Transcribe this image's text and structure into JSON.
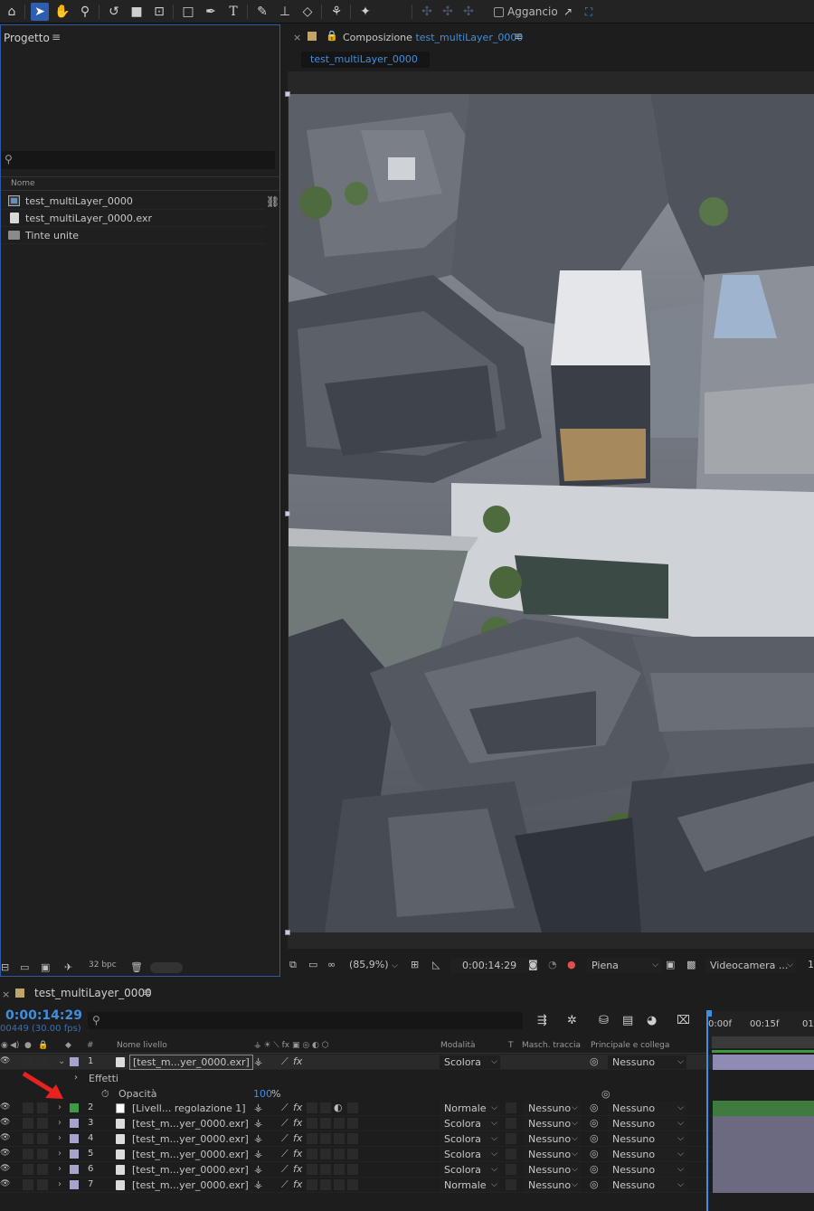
{
  "toolbar": {
    "snap_label": "Aggancio",
    "icons": [
      "home-icon",
      "selection-tool-icon",
      "hand-tool-icon",
      "zoom-tool-icon",
      "rotate-tool-icon",
      "camera-tool-icon",
      "pan-behind-tool-icon",
      "rectangle-tool-icon",
      "pen-tool-icon",
      "type-tool-icon",
      "brush-tool-icon",
      "clone-stamp-tool-icon",
      "eraser-tool-icon",
      "roto-brush-tool-icon",
      "puppet-pin-tool-icon"
    ]
  },
  "project": {
    "title": "Progetto",
    "column_name": "Nome",
    "items": [
      {
        "name": "test_multiLayer_0000",
        "type": "composition"
      },
      {
        "name": "test_multiLayer_0000.exr",
        "type": "footage"
      },
      {
        "name": "Tinte unite",
        "type": "folder"
      }
    ],
    "bit_depth": "32 bpc"
  },
  "composition": {
    "panel_prefix": "Composizione",
    "name": "test_multiLayer_0000",
    "tab": "test_multiLayer_0000",
    "zoom": "(85,9%)",
    "current_time": "0:00:14:29",
    "resolution": "Piena",
    "camera": "Videocamera ...",
    "views": "1"
  },
  "timeline": {
    "title": "test_multiLayer_0000",
    "timecode": "0:00:14:29",
    "frames_info": "00449 (30.00 fps)",
    "ruler_ticks": [
      "0:00f",
      "00:15f",
      "01"
    ],
    "columns": {
      "hash": "#",
      "layer_name": "Nome livello",
      "mode": "Modalità",
      "t": "T",
      "track_matte": "Masch. traccia",
      "parent": "Principale e collega"
    },
    "effects_label": "Effetti",
    "opacity_label": "Opacità",
    "opacity_value": "100",
    "opacity_unit": "%",
    "layers": [
      {
        "num": "1",
        "name": "[test_m...yer_0000.exr]",
        "mode": "Scolora",
        "matte": "",
        "parent": "Nessuno",
        "color": "#a7a3cf",
        "selected": true
      },
      {
        "num": "2",
        "name": "[Livell... regolazione 1]",
        "mode": "Normale",
        "matte": "Nessuno",
        "parent": "Nessuno",
        "color": "#3f9a44",
        "selected": false
      },
      {
        "num": "3",
        "name": "[test_m...yer_0000.exr]",
        "mode": "Scolora",
        "matte": "Nessuno",
        "parent": "Nessuno",
        "color": "#a7a3cf",
        "selected": false
      },
      {
        "num": "4",
        "name": "[test_m...yer_0000.exr]",
        "mode": "Scolora",
        "matte": "Nessuno",
        "parent": "Nessuno",
        "color": "#a7a3cf",
        "selected": false
      },
      {
        "num": "5",
        "name": "[test_m...yer_0000.exr]",
        "mode": "Scolora",
        "matte": "Nessuno",
        "parent": "Nessuno",
        "color": "#a7a3cf",
        "selected": false
      },
      {
        "num": "6",
        "name": "[test_m...yer_0000.exr]",
        "mode": "Scolora",
        "matte": "Nessuno",
        "parent": "Nessuno",
        "color": "#a7a3cf",
        "selected": false
      },
      {
        "num": "7",
        "name": "[test_m...yer_0000.exr]",
        "mode": "Normale",
        "matte": "Nessuno",
        "parent": "Nessuno",
        "color": "#a7a3cf",
        "selected": false
      }
    ]
  },
  "colors": {
    "accent": "#3f8fe0",
    "panel_border": "#2c5aa8",
    "adjustment_layer": "#3f9a44",
    "footage_layer": "#a7a3cf",
    "annotation_arrow": "#e8231f"
  }
}
